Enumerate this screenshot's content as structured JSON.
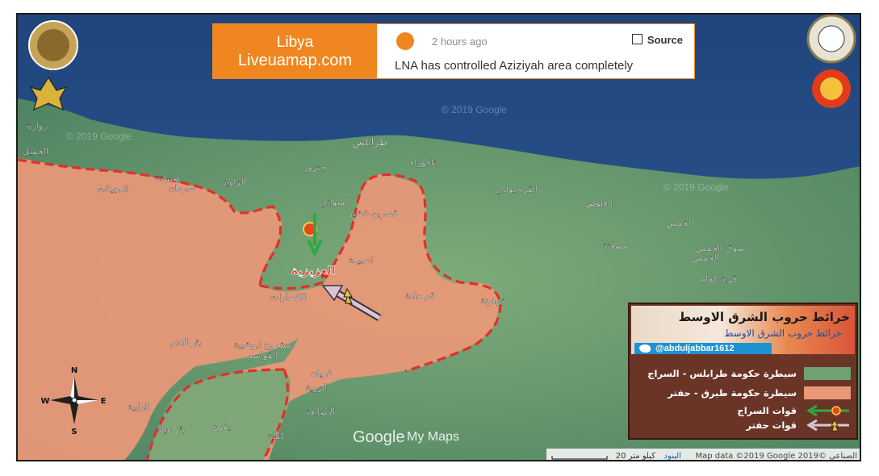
{
  "news_card": {
    "brand_line1": "Libya",
    "brand_line2": "Liveuamap.com",
    "time": "2 hours ago",
    "source_label": "Source",
    "headline": "LNA has controlled Aziziyah area completely"
  },
  "legend": {
    "title": "خرائط حروب الشرق الاوسط",
    "subtitle": "خرائط حروب الشرق الاوسط",
    "twitter_handle": "@abduljabbar1612",
    "items": [
      {
        "label": "سيطرة حكومة طرابلس - السراج",
        "color": "#6fa173"
      },
      {
        "label": "سيطرة حكومة طبرق - حفتر",
        "color": "#ea9878"
      },
      {
        "label": "قوات السراج",
        "color": "#2eaa3f"
      },
      {
        "label": "قوات حفتر",
        "color": "#d8c8d8"
      }
    ]
  },
  "map": {
    "highlight_label": "العزيزية",
    "watermark_brand": "Google",
    "watermark_product": "My Maps",
    "attribution": "Map data ©2019 Google 2019© الصناعي",
    "scale_label": "20 كيلو متر",
    "terms_label": "البنود",
    "copyright_watermark": "© 2019 Google",
    "places": [
      "طرابلس",
      "تاجوراء",
      "جنزور",
      "الزاوية",
      "صبراتة",
      "صرمان",
      "العجيلات",
      "زوارة",
      "الجميل",
      "السواني",
      "قصربن غشير",
      "القره بوللي",
      "العلوص",
      "الخمس",
      "مسلاتة",
      "سوق الخمس",
      "الخمس",
      "قرية كمام",
      "اسبيعة",
      "ترهونة",
      "قم ملغة",
      "الكسارات",
      "بئر الغنم",
      "مشروع ابوشيبة",
      "القواسم",
      "غريان",
      "الزوية",
      "الاصابعة",
      "ككلة",
      "يفرن",
      "بئر عياد",
      "الرابية"
    ],
    "compass": {
      "north": "N",
      "south": "S",
      "east": "E",
      "west": "W"
    },
    "colors": {
      "sea": "#2b548f",
      "gna_land": "#6fa173",
      "lna_land": "#ea9878",
      "front_line": "#e0302a",
      "lna_arrow": "#d9c5d6",
      "gna_arrow": "#2eaa3f"
    },
    "icons": [
      "lna-emblem-icon",
      "gna-emblem-icon",
      "compass-rose-icon",
      "army-seal-icon"
    ]
  }
}
